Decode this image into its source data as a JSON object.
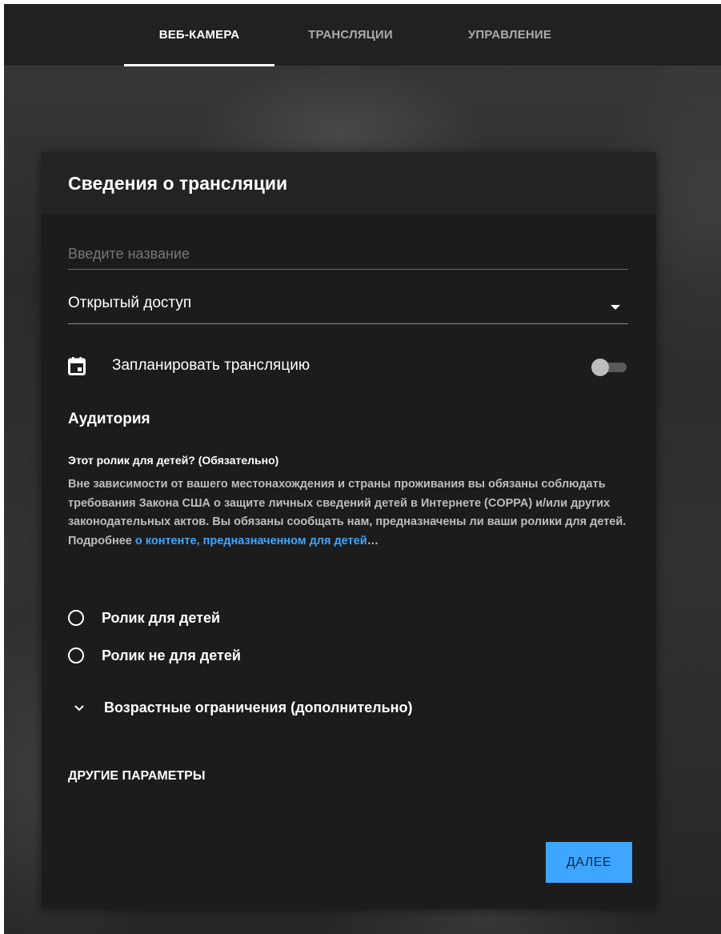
{
  "tabs": [
    {
      "label": "ВЕБ-КАМЕРА",
      "active": true
    },
    {
      "label": "ТРАНСЛЯЦИИ",
      "active": false
    },
    {
      "label": "УПРАВЛЕНИЕ",
      "active": false
    }
  ],
  "card": {
    "title": "Сведения о трансляции",
    "title_input": {
      "placeholder": "Введите название",
      "value": ""
    },
    "privacy": {
      "selected": "Открытый доступ"
    },
    "schedule": {
      "icon": "calendar-icon",
      "label": "Запланировать трансляцию",
      "enabled": false
    },
    "audience": {
      "heading": "Аудитория",
      "question": "Этот ролик для детей? (Обязательно)",
      "description": "Вне зависимости от вашего местонахождения и страны проживания вы обязаны соблюдать требования Закона США о защите личных сведений детей в Интернете (COPPA) и/или других законодательных актов. Вы обязаны сообщать нам, предназначены ли ваши ролики для детей. Подробнее ",
      "link_text": "о контенте, предназначенном для детей",
      "ellipsis": "…",
      "options": [
        {
          "label": "Ролик для детей",
          "selected": false
        },
        {
          "label": "Ролик не для детей",
          "selected": false
        }
      ]
    },
    "age_restrictions": {
      "icon": "chevron-down-icon",
      "label": "Возрастные ограничения (дополнительно)"
    },
    "other_params_label": "ДРУГИЕ ПАРАМЕТРЫ",
    "next_label": "ДАЛЕЕ"
  },
  "colors": {
    "accent": "#3ea6ff",
    "surface": "#1c1c1c",
    "header": "#212121",
    "link": "#3ea6ff"
  }
}
